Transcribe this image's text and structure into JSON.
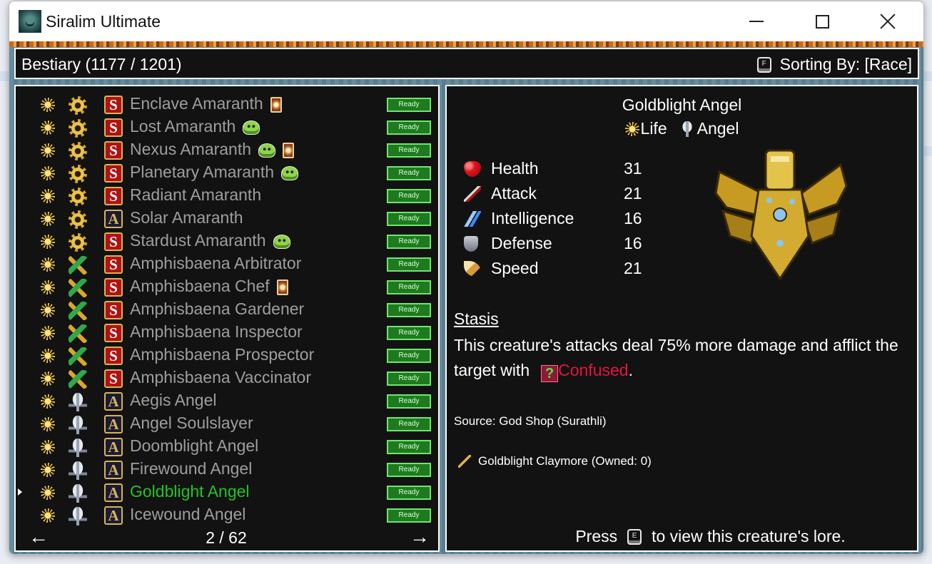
{
  "window": {
    "title": "Siralim Ultimate"
  },
  "header": {
    "title": "Bestiary (1177 / 1201)",
    "sort_key": "F",
    "sort_label": "Sorting By: [Race]"
  },
  "list": {
    "rows": [
      {
        "name": "Enclave Amaranth",
        "race": "amaranth",
        "klass": "S",
        "extras": [
          "card"
        ],
        "status": "Ready"
      },
      {
        "name": "Lost Amaranth",
        "race": "amaranth",
        "klass": "S",
        "extras": [
          "slime"
        ],
        "status": "Ready"
      },
      {
        "name": "Nexus Amaranth",
        "race": "amaranth",
        "klass": "S",
        "extras": [
          "slime",
          "card"
        ],
        "status": "Ready"
      },
      {
        "name": "Planetary Amaranth",
        "race": "amaranth",
        "klass": "S",
        "extras": [
          "slime"
        ],
        "status": "Ready"
      },
      {
        "name": "Radiant Amaranth",
        "race": "amaranth",
        "klass": "S",
        "extras": [],
        "status": "Ready"
      },
      {
        "name": "Solar Amaranth",
        "race": "amaranth",
        "klass": "A",
        "extras": [],
        "status": "Ready"
      },
      {
        "name": "Stardust Amaranth",
        "race": "amaranth",
        "klass": "S",
        "extras": [
          "slime"
        ],
        "status": "Ready"
      },
      {
        "name": "Amphisbaena Arbitrator",
        "race": "amphi",
        "klass": "S",
        "extras": [],
        "status": "Ready"
      },
      {
        "name": "Amphisbaena Chef",
        "race": "amphi",
        "klass": "S",
        "extras": [
          "card"
        ],
        "status": "Ready"
      },
      {
        "name": "Amphisbaena Gardener",
        "race": "amphi",
        "klass": "S",
        "extras": [],
        "status": "Ready"
      },
      {
        "name": "Amphisbaena Inspector",
        "race": "amphi",
        "klass": "S",
        "extras": [],
        "status": "Ready"
      },
      {
        "name": "Amphisbaena Prospector",
        "race": "amphi",
        "klass": "S",
        "extras": [],
        "status": "Ready"
      },
      {
        "name": "Amphisbaena Vaccinator",
        "race": "amphi",
        "klass": "S",
        "extras": [],
        "status": "Ready"
      },
      {
        "name": "Aegis Angel",
        "race": "angel",
        "klass": "A",
        "extras": [],
        "status": "Ready"
      },
      {
        "name": "Angel Soulslayer",
        "race": "angel",
        "klass": "A",
        "extras": [],
        "status": "Ready"
      },
      {
        "name": "Doomblight Angel",
        "race": "angel",
        "klass": "A",
        "extras": [],
        "status": "Ready"
      },
      {
        "name": "Firewound Angel",
        "race": "angel",
        "klass": "A",
        "extras": [],
        "status": "Ready"
      },
      {
        "name": "Goldblight Angel",
        "race": "angel",
        "klass": "A",
        "extras": [],
        "status": "Ready",
        "selected": true
      },
      {
        "name": "Icewound Angel",
        "race": "angel",
        "klass": "A",
        "extras": [],
        "status": "Ready"
      }
    ],
    "page": "2 / 62",
    "prev_glyph": "←",
    "next_glyph": "→"
  },
  "detail": {
    "name": "Goldblight Angel",
    "type_1": "Life",
    "type_2": "Angel",
    "stats": [
      {
        "label": "Health",
        "value": "31",
        "icon": "heart-icon"
      },
      {
        "label": "Attack",
        "value": "21",
        "icon": "sword-icon"
      },
      {
        "label": "Intelligence",
        "value": "16",
        "icon": "bolt-icon"
      },
      {
        "label": "Defense",
        "value": "16",
        "icon": "shield-icon"
      },
      {
        "label": "Speed",
        "value": "21",
        "icon": "feather-icon"
      }
    ],
    "ability_name": "Stasis",
    "ability_text_1": "This creature's attacks deal 75% more damage and afflict the target with",
    "status_icon_glyph": "?",
    "status_name": "Confused",
    "ability_text_end": ".",
    "source": "Source: God Shop (Surathli)",
    "artifact": "Goldblight Claymore (Owned: 0)",
    "lore_press": "Press",
    "lore_key": "E",
    "lore_rest": "to view this creature's lore."
  },
  "colors": {
    "panel_bg": "#121212",
    "text": "#ffffff",
    "inactive_name": "#9e9e9e",
    "selected_name": "#22c422",
    "ready_bg": "#1e7a1e",
    "confused": "#e8143f"
  }
}
